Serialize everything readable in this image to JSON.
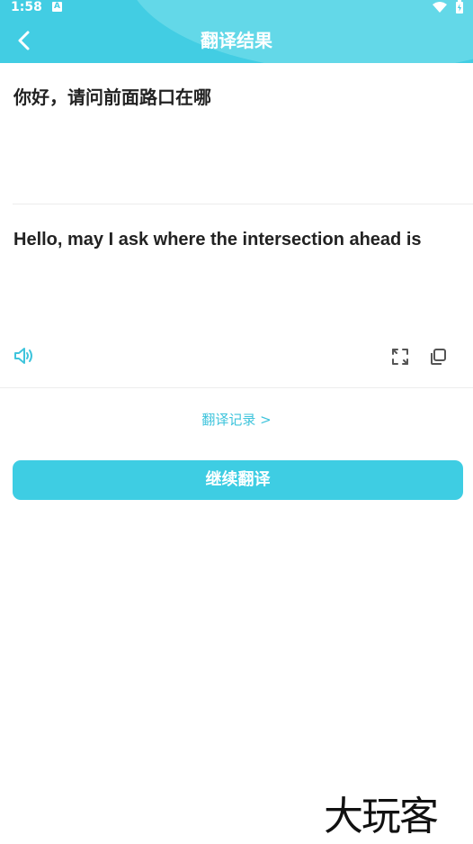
{
  "status_bar": {
    "time": "1:58",
    "notification_icon": "a-icon"
  },
  "header": {
    "title": "翻译结果",
    "back_icon": "back-arrow-icon"
  },
  "source_text": "你好，请问前面路口在哪",
  "translated_text": "Hello, may I ask where the intersection ahead is",
  "actions": {
    "speak_icon": "speaker-icon",
    "fullscreen_icon": "expand-icon",
    "copy_icon": "copy-icon"
  },
  "history_link": "翻译记录 >",
  "continue_button": "继续翻译",
  "watermark": "大玩客",
  "colors": {
    "accent": "#42cde3",
    "accent_light": "#63d8e8",
    "link": "#3fc4dc",
    "text": "#222222"
  }
}
